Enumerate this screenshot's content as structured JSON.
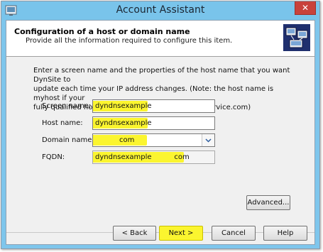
{
  "window": {
    "title": "Account Assistant",
    "close_glyph": "✕"
  },
  "header": {
    "title": "Configuration of a host or domain name",
    "subtitle": "Provide all the information required to configure this item.",
    "icon": "network-computers-icon"
  },
  "description": [
    "Enter a screen name and the properties of the host name that you want DynSite to",
    "update each time your IP address changes. (Note: the host name is myhost if your",
    "fully qualified host name is for example myhost.service.com)"
  ],
  "form": {
    "screen_name": {
      "label": "Screen name:",
      "value": "dyndnsexample"
    },
    "host_name": {
      "label": "Host name:",
      "value": "dyndnsexample"
    },
    "domain_name": {
      "label": "Domain name:",
      "value": "com"
    },
    "fqdn": {
      "label": "FQDN:",
      "value": "dyndnsexample          com"
    }
  },
  "buttons": {
    "advanced": "Advanced...",
    "back": "< Back",
    "next": "Next >",
    "cancel": "Cancel",
    "help": "Help"
  },
  "colors": {
    "highlight": "#fbf52f",
    "titlebar": "#79c4eb",
    "close": "#c8423b"
  }
}
